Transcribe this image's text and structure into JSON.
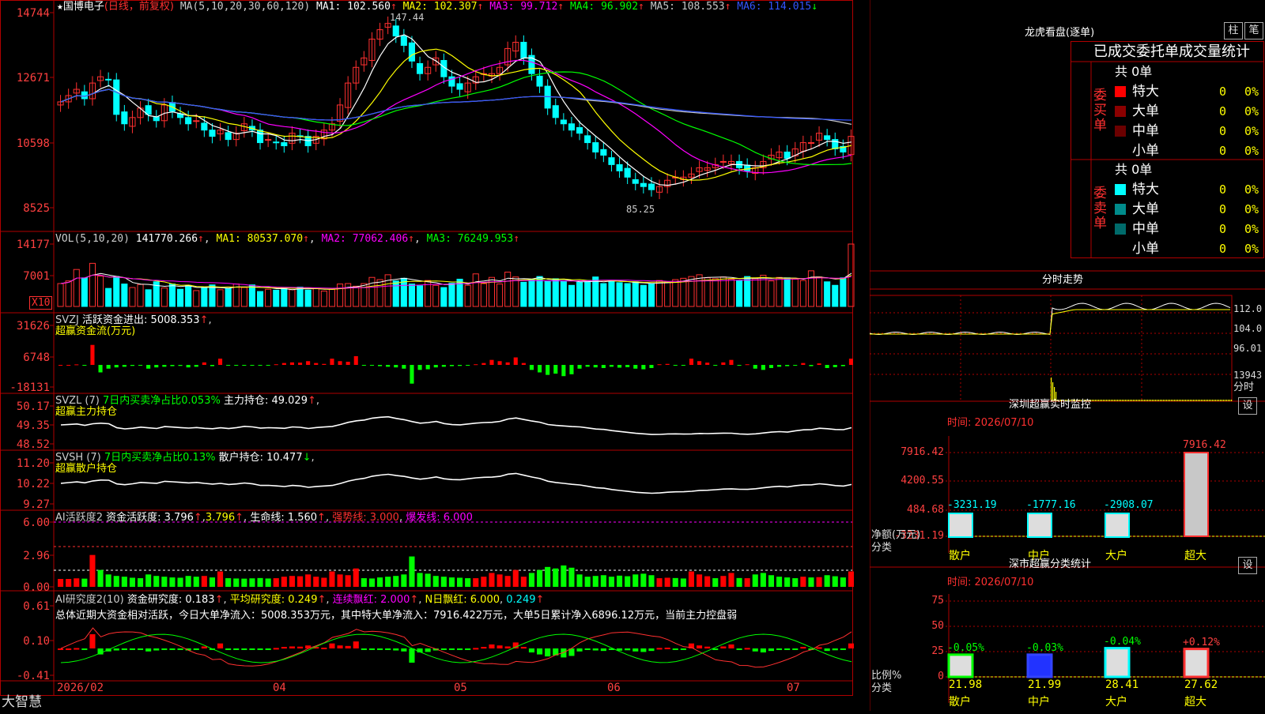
{
  "app": {
    "brand": "大智慧",
    "star": "★"
  },
  "panels": {
    "price": {
      "title": "国博电子",
      "mode": "(日线，前复权)",
      "ma_header": "MA(5,10,20,30,60,120)",
      "ma": [
        {
          "label": "MA1: 102.560",
          "arrow": "↑",
          "color": "#ffffff"
        },
        {
          "label": "MA2: 102.307",
          "arrow": "↑",
          "color": "#ffff00"
        },
        {
          "label": "MA3: 99.712",
          "arrow": "↑",
          "color": "#ff00ff"
        },
        {
          "label": "MA4: 96.902",
          "arrow": "↑",
          "color": "#00ff00"
        },
        {
          "label": "MA5: 108.553",
          "arrow": "↑",
          "color": "#c8c8c8"
        },
        {
          "label": "MA6: 114.015",
          "arrow": "↓",
          "color": "#3355ff"
        }
      ],
      "yticks": [
        "14744",
        "12671",
        "10598",
        "8525"
      ],
      "high_note": "147.44",
      "low_note": "85.25"
    },
    "volume": {
      "header": "VOL(5,10,20)",
      "value": "141770.266",
      "arrow": "↑",
      "ma1": "MA1: 80537.070",
      "ma2": "MA2: 77062.406",
      "ma3": "MA3: 76249.953",
      "yticks": [
        "14177",
        "7001"
      ],
      "unit": "X10"
    },
    "svzj": {
      "header": "SVZJ",
      "text": "活跃资金进出: 5008.353",
      "arrow": "↑",
      "sub": "超赢资金流(万元)",
      "yticks": [
        "31626",
        "6748",
        "-18131"
      ]
    },
    "svzl": {
      "header": "SVZL (7)",
      "green_text": "7日内买卖净占比0.053%",
      "text": "主力持仓: 49.029",
      "arrow": "↑",
      "sub": "超赢主力持仓",
      "yticks": [
        "50.17",
        "49.35",
        "48.52"
      ]
    },
    "svsh": {
      "header": "SVSH (7)",
      "green_text": "7日内买卖净占比0.13%",
      "text": "散户持仓: 10.477",
      "arrow": "↓",
      "sub": "超赢散户持仓",
      "yticks": [
        "11.20",
        "10.22",
        "9.27"
      ]
    },
    "ai_active": {
      "header": "AI活跃度2",
      "text": "资金活跃度: 3.796",
      "arrow": "↑",
      "text2": "3.796",
      "life": "生命线: 1.560",
      "strong": "强势线: 3.000",
      "burst": "爆发线: 6.000",
      "yticks": [
        "6.00",
        "2.96",
        "0.00"
      ]
    },
    "ai_research": {
      "header": "AI研究度2(10)",
      "text": "资金研究度: 0.183",
      "avg": "平均研究度: 0.249",
      "cont": "连续飘红: 2.000",
      "nday": "N日飘红: 6.000",
      "last": "0.249",
      "summary": "总体近期大资金相对活跃，今日大单净流入：5008.353万元，其中特大单净流入：7916.422万元，大单5日累计净入6896.12万元，当前主力控盘弱",
      "yticks": [
        "0.61",
        "0.10",
        "-0.41"
      ]
    },
    "xaxis": [
      "2026/02",
      "04",
      "05",
      "06",
      "07"
    ]
  },
  "side": {
    "dragon": {
      "title": "龙虎看盘(逐单)",
      "btn1": "柱",
      "btn2": "笔",
      "header": "已成交委托单成交量统计",
      "buy_label": "委买单",
      "sell_label": "委卖单",
      "buy_total": "共 0单",
      "sell_total": "共 0单",
      "buy_rows": [
        {
          "name": "特大",
          "count": "0",
          "pct": "0%",
          "color": "#ff0000"
        },
        {
          "name": "大单",
          "count": "0",
          "pct": "0%",
          "color": "#8b0000"
        },
        {
          "name": "中单",
          "count": "0",
          "pct": "0%",
          "color": "#6b0000"
        },
        {
          "name": "小单",
          "count": "0",
          "pct": "0%",
          "color": "#000000"
        }
      ],
      "sell_rows": [
        {
          "name": "特大",
          "count": "0",
          "pct": "0%",
          "color": "#00ffff"
        },
        {
          "name": "大单",
          "count": "0",
          "pct": "0%",
          "color": "#008b8b"
        },
        {
          "name": "中单",
          "count": "0",
          "pct": "0%",
          "color": "#006b6b"
        },
        {
          "name": "小单",
          "count": "0",
          "pct": "0%",
          "color": "#000000"
        }
      ]
    },
    "intraday": {
      "title": "分时走势",
      "yticks": [
        "112.0",
        "104.0",
        "96.01"
      ],
      "vol_label": "13943",
      "time_label": "分时"
    },
    "sz_monitor": {
      "title": "深圳超赢实时监控",
      "btn": "设",
      "time": "时间: 2026/07/10",
      "yticks": [
        "7916.42",
        "4200.55",
        "484.68",
        "-3231.19"
      ],
      "ylabel": "净额(万元)",
      "xlabel": "分类",
      "categories": [
        "散户",
        "中户",
        "大户",
        "超大"
      ],
      "values": [
        -3231.19,
        -1777.16,
        -2908.07,
        7916.42
      ],
      "value_labels": [
        "-3231.19",
        "-1777.16",
        "-2908.07",
        "7916.42"
      ]
    },
    "sz_class": {
      "title": "深市超赢分类统计",
      "btn": "设",
      "time": "时间: 2026/07/10",
      "yticks": [
        "75",
        "50",
        "25",
        "0"
      ],
      "ylabel": "比例%",
      "xlabel": "分类",
      "categories": [
        "散户",
        "中户",
        "大户",
        "超大"
      ],
      "values": [
        21.98,
        21.99,
        28.41,
        27.62
      ],
      "value_labels": [
        "21.98",
        "21.99",
        "28.41",
        "27.62"
      ],
      "changes": [
        "-0.05%",
        "-0.03%",
        "-0.04%",
        "+0.12%"
      ]
    }
  },
  "chart_data": [
    {
      "type": "candlestick",
      "title": "国博电子",
      "ylim": [
        85.25,
        147.44
      ],
      "note": "price series (per-day close values estimated from the plot)",
      "close": [
        119,
        121,
        123,
        120,
        125,
        127,
        126,
        115,
        112,
        114,
        117,
        115,
        113,
        118,
        116,
        114,
        112,
        113,
        110,
        108,
        110,
        107,
        109,
        112,
        110,
        106,
        107,
        106,
        105,
        109,
        108,
        105,
        108,
        110,
        112,
        118,
        125,
        130,
        133,
        139,
        142,
        144,
        140,
        137,
        132,
        128,
        130,
        133,
        127,
        124,
        123,
        125,
        127,
        128,
        128,
        130,
        136,
        138,
        133,
        128,
        124,
        117,
        114,
        112,
        110,
        109,
        106,
        103,
        102,
        99,
        97,
        95,
        93,
        92,
        91,
        92,
        94,
        95,
        95,
        96,
        98,
        98,
        99,
        100,
        100,
        98,
        97,
        98,
        100,
        102,
        103,
        101,
        104,
        106,
        106,
        109,
        107,
        104,
        103,
        108
      ]
    },
    {
      "type": "bar",
      "title": "VOL(5,10,20)",
      "note": "daily volume x10 (estimated)",
      "ylim": [
        0,
        14177
      ],
      "values": [
        5200,
        5800,
        8400,
        6500,
        9800,
        6900,
        4100,
        6800,
        5100,
        4300,
        5000,
        3800,
        5600,
        4200,
        5100,
        3900,
        4800,
        3600,
        4300,
        4900,
        3800,
        4100,
        5100,
        4300,
        4900,
        3400,
        3900,
        3700,
        4300,
        3800,
        4400,
        3700,
        4100,
        3500,
        3900,
        5100,
        5200,
        4600,
        5200,
        6600,
        6100,
        7200,
        5800,
        6400,
        5100,
        4700,
        5900,
        4800,
        4300,
        5300,
        6200,
        4800,
        7400,
        5200,
        6600,
        5100,
        7800,
        6700,
        5500,
        6100,
        6800,
        5800,
        6300,
        5700,
        4800,
        5500,
        5900,
        6700,
        5200,
        5800,
        5400,
        5200,
        5600,
        4800,
        5100,
        5900,
        5500,
        6100,
        6400,
        6800,
        7200,
        6500,
        6300,
        6700,
        6200,
        5900,
        6800,
        6300,
        7100,
        5800,
        6600,
        6500,
        6200,
        5900,
        8100,
        6700,
        5600,
        4800,
        6500,
        14177
      ]
    },
    {
      "type": "bar",
      "title": "SVZJ",
      "ylim": [
        -18131,
        31626
      ],
      "note": "活跃资金进出 bars (estimated)",
      "values": [
        0,
        0,
        400,
        -200,
        16000,
        -6000,
        -3000,
        -2000,
        -1500,
        -800,
        -500,
        -3000,
        -2000,
        -1500,
        -1000,
        -800,
        -2000,
        -1500,
        2000,
        -1000,
        5000,
        -500,
        -300,
        -200,
        -400,
        -600,
        -300,
        500,
        1500,
        2000,
        1800,
        3000,
        1500,
        800,
        5000,
        3000,
        2500,
        7000,
        -500,
        -300,
        -1000,
        -1500,
        -2000,
        -3000,
        -15000,
        -4000,
        -3500,
        -2000,
        -1500,
        -1000,
        -800,
        -500,
        500,
        1500,
        4000,
        3000,
        2000,
        6000,
        1500,
        -4000,
        -6000,
        -8000,
        -7000,
        -9000,
        -7500,
        -3000,
        -1500,
        -2000,
        -2500,
        -1500,
        -2200,
        -1800,
        -3000,
        -3500,
        -2500,
        500,
        800,
        -600,
        -300,
        5000,
        3000,
        1800,
        -500,
        2000,
        4000,
        -600,
        500,
        -3000,
        -4000,
        -2500,
        -1500,
        -1000,
        -500,
        1500,
        -1000,
        1200,
        -2500,
        -1800,
        -1000,
        5008
      ]
    }
  ]
}
